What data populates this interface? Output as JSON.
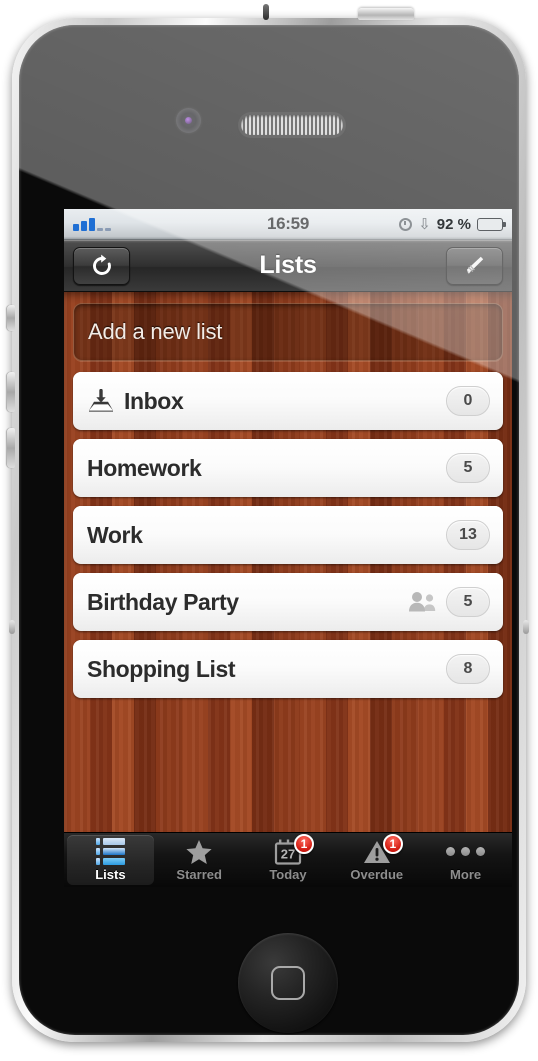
{
  "device": {
    "name": "smartphone",
    "hardware": {
      "front_camera": "front-camera",
      "earpiece": "earpiece-speaker",
      "home_button": "home-button",
      "power_button": "power-button",
      "volume_buttons": [
        "volume-up",
        "volume-down",
        "mute-switch"
      ]
    }
  },
  "status_bar": {
    "signal_label": "signal-bars",
    "time": "16:59",
    "clock_icon": "alarm-clock-icon",
    "bluetooth_icon": "bluetooth-icon",
    "battery_percent": "92 %",
    "battery_icon": "battery-icon",
    "battery_level": 92
  },
  "nav_bar": {
    "title": "Lists",
    "left_button": {
      "name": "refresh-sync-button",
      "icon": "refresh-icon"
    },
    "right_button": {
      "name": "edit-button",
      "icon": "pencil-icon"
    }
  },
  "content": {
    "add_new": {
      "label": "Add a new list",
      "placeholder": "Add a new list"
    },
    "rows": [
      {
        "label": "Inbox",
        "count": "0",
        "icon": "inbox-tray-icon",
        "shared": false
      },
      {
        "label": "Homework",
        "count": "5",
        "icon": null,
        "shared": false
      },
      {
        "label": "Work",
        "count": "13",
        "icon": null,
        "shared": false
      },
      {
        "label": "Birthday Party",
        "count": "5",
        "icon": null,
        "shared": true
      },
      {
        "label": "Shopping List",
        "count": "8",
        "icon": null,
        "shared": false
      }
    ]
  },
  "tab_bar": {
    "items": [
      {
        "label": "Lists",
        "icon": "list-bullets-icon",
        "selected": true,
        "badge": null
      },
      {
        "label": "Starred",
        "icon": "star-icon",
        "selected": false,
        "badge": null
      },
      {
        "label": "Today",
        "icon": "calendar-icon",
        "selected": false,
        "badge": "1",
        "calendar_day": "27"
      },
      {
        "label": "Overdue",
        "icon": "warning-triangle-icon",
        "selected": false,
        "badge": "1"
      },
      {
        "label": "More",
        "icon": "ellipsis-icon",
        "selected": false,
        "badge": null
      }
    ]
  },
  "colors": {
    "wood": "#8a3a1b",
    "accent_blue": "#2b9ae0",
    "badge_red": "#d21b11",
    "battery_green": "#5cb31f",
    "signal_blue": "#1f6fd4"
  }
}
